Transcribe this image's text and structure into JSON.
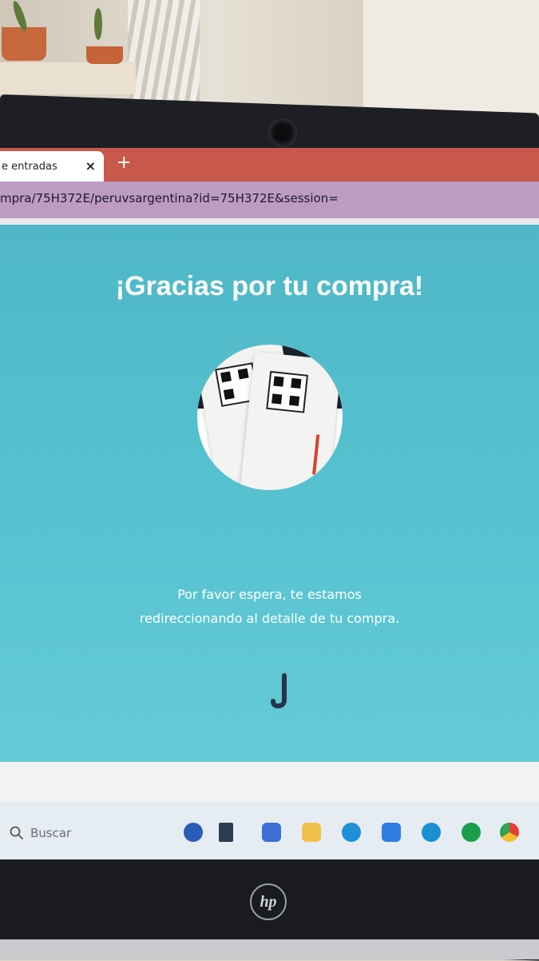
{
  "browser": {
    "tab_title": "e entradas",
    "tab_close": "×",
    "new_tab": "+",
    "url": "mpra/75H372E/peruvsargentina?id=75H372E&session="
  },
  "page": {
    "title": "¡Gracias por tu compra!",
    "message_line1": "Por favor espera, te estamos",
    "message_line2": "redireccionando al detalle de tu compra.",
    "spinner_icon": "loading-spinner-icon"
  },
  "taskbar": {
    "search_placeholder": "Buscar",
    "apps": [
      "bing-chat-icon",
      "l-app-icon",
      "copilot-icon",
      "file-explorer-icon",
      "edge-icon",
      "store-icon",
      "app-icon",
      "spotify-icon",
      "chrome-icon"
    ]
  },
  "device": {
    "logo": "hp"
  },
  "colors": {
    "accent": "#4fb7c7",
    "tab_bar": "#c8584b",
    "address_bar": "#bd9cc3"
  }
}
